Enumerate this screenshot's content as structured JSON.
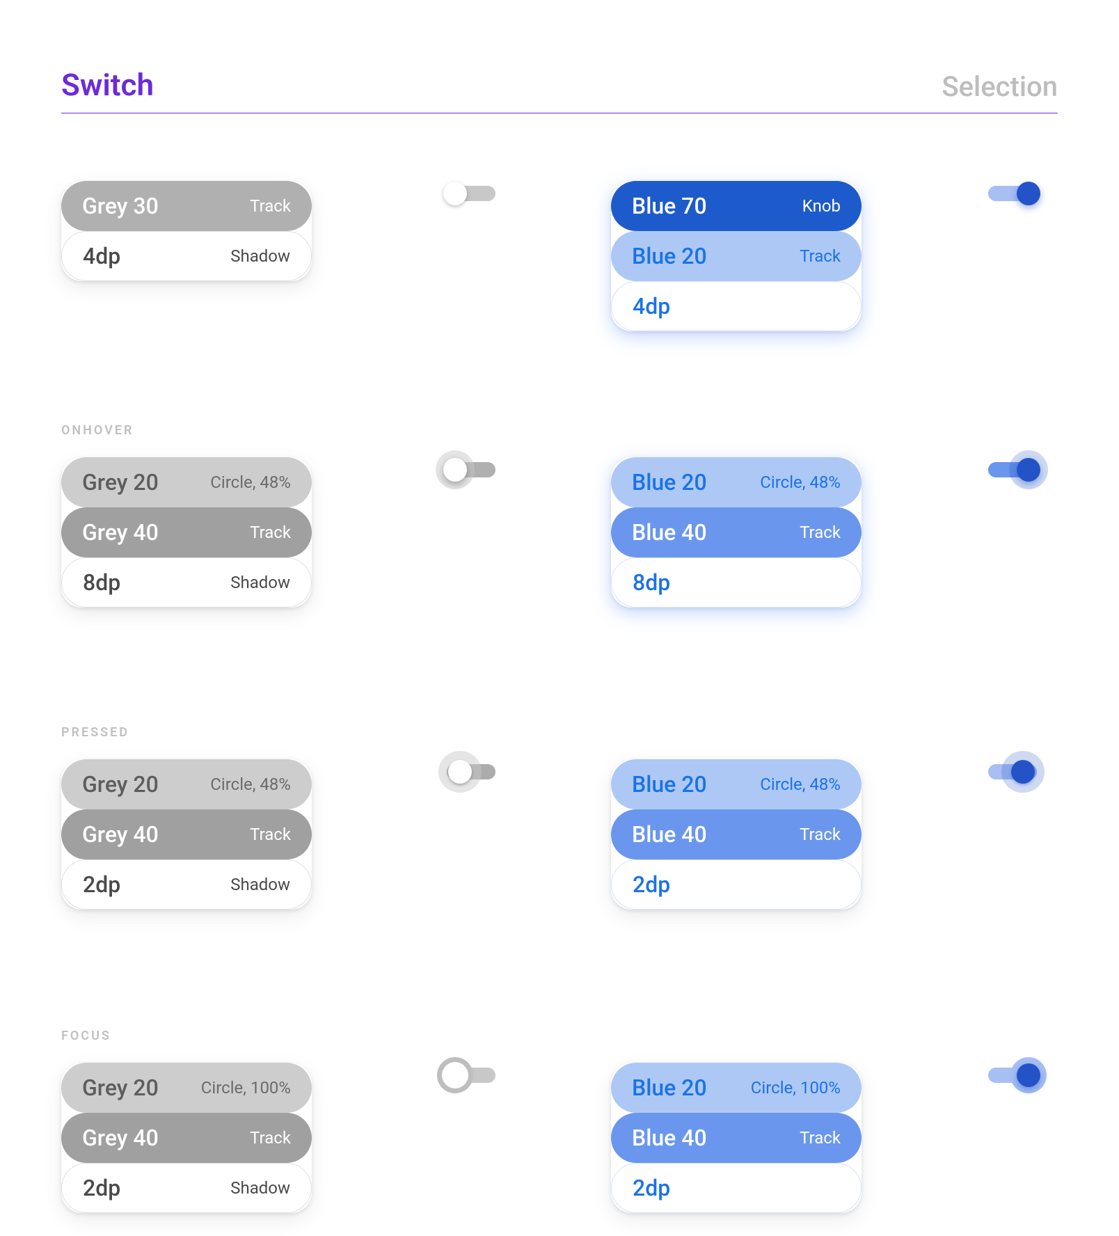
{
  "header": {
    "title": "Switch",
    "subtitle": "Selection"
  },
  "states": {
    "default": {
      "label": "",
      "off": [
        {
          "cls": "grey30",
          "left": "Grey 30",
          "right": "Track"
        },
        {
          "cls": "white-off",
          "left": "4dp",
          "right": "Shadow"
        }
      ],
      "on": [
        {
          "cls": "blue70",
          "left": "Blue 70",
          "right": "Knob"
        },
        {
          "cls": "blue20",
          "left": "Blue 20",
          "right": "Track"
        },
        {
          "cls": "white-on",
          "left": "4dp",
          "right": ""
        }
      ]
    },
    "onhover": {
      "label": "ONHOVER",
      "off": [
        {
          "cls": "grey20",
          "left": "Grey 20",
          "right": "Circle, 48%"
        },
        {
          "cls": "grey40",
          "left": "Grey 40",
          "right": "Track"
        },
        {
          "cls": "white-off",
          "left": "8dp",
          "right": "Shadow"
        }
      ],
      "on": [
        {
          "cls": "blue20",
          "left": "Blue 20",
          "right": "Circle, 48%"
        },
        {
          "cls": "blue40",
          "left": "Blue 40",
          "right": "Track"
        },
        {
          "cls": "white-on",
          "left": "8dp",
          "right": ""
        }
      ]
    },
    "pressed": {
      "label": "PRESSED",
      "off": [
        {
          "cls": "grey20",
          "left": "Grey 20",
          "right": "Circle, 48%"
        },
        {
          "cls": "grey40",
          "left": "Grey 40",
          "right": "Track"
        },
        {
          "cls": "white-off",
          "left": "2dp",
          "right": "Shadow"
        }
      ],
      "on": [
        {
          "cls": "blue20",
          "left": "Blue 20",
          "right": "Circle, 48%"
        },
        {
          "cls": "blue40",
          "left": "Blue 40",
          "right": "Track"
        },
        {
          "cls": "white-on",
          "left": "2dp",
          "right": ""
        }
      ]
    },
    "focus": {
      "label": "FOCUS",
      "off": [
        {
          "cls": "grey20",
          "left": "Grey 20",
          "right": "Circle, 100%"
        },
        {
          "cls": "grey40",
          "left": "Grey 40",
          "right": "Track"
        },
        {
          "cls": "white-off",
          "left": "2dp",
          "right": "Shadow"
        }
      ],
      "on": [
        {
          "cls": "blue20",
          "left": "Blue 20",
          "right": "Circle, 100%"
        },
        {
          "cls": "blue40",
          "left": "Blue 40",
          "right": "Track"
        },
        {
          "cls": "white-on",
          "left": "2dp",
          "right": ""
        }
      ]
    }
  }
}
